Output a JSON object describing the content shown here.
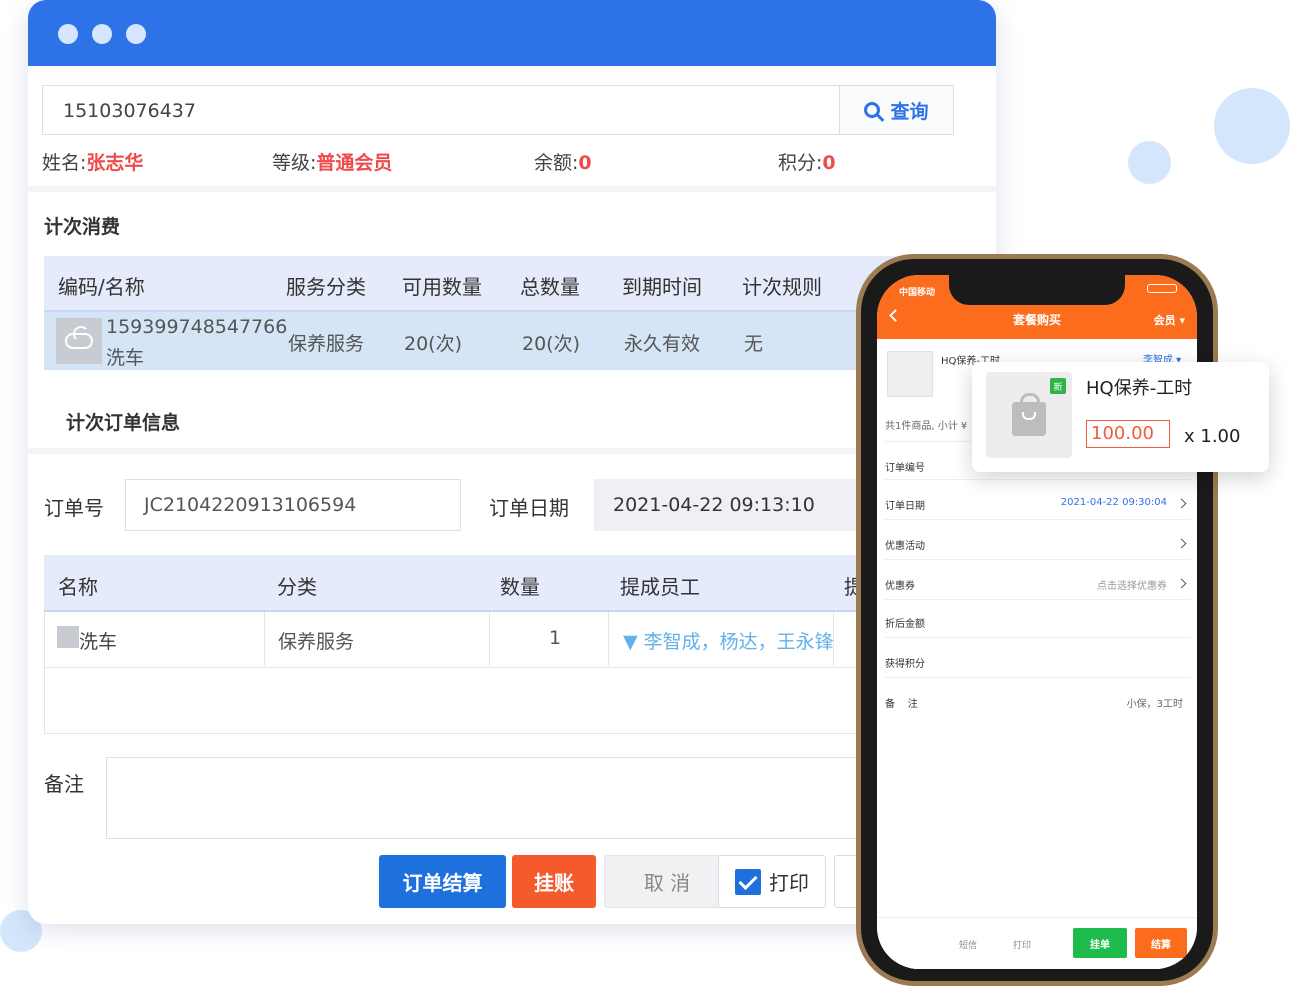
{
  "search": {
    "value": "15103076437",
    "button_label": "查询"
  },
  "member": {
    "name_label": "姓名:",
    "name_value": "张志华",
    "level_label": "等级:",
    "level_value": "普通会员",
    "balance_label": "余额:",
    "balance_value": "0",
    "points_label": "积分:",
    "points_value": "0"
  },
  "consume": {
    "title": "计次消费",
    "headers": [
      "编码/名称",
      "服务分类",
      "可用数量",
      "总数量",
      "到期时间",
      "计次规则"
    ],
    "row": {
      "code": "159399748547766",
      "name": "洗车",
      "category": "保养服务",
      "available": "20(次)",
      "total": "20(次)",
      "expiry": "永久有效",
      "rule": "无"
    }
  },
  "order": {
    "title": "计次订单信息",
    "order_no_label": "订单号",
    "order_no": "JC2104220913106594",
    "date_label": "订单日期",
    "date": "2021-04-22 09:13:10",
    "headers": [
      "名称",
      "分类",
      "数量",
      "提成员工",
      "提"
    ],
    "row": {
      "name": "洗车",
      "category": "保养服务",
      "qty": "1",
      "staff": "▼ 李智成，杨达，王永锋"
    },
    "remark_label": "备注"
  },
  "buttons": {
    "settle": "订单结算",
    "hang": "挂账",
    "cancel": "取 消",
    "print": "打印"
  },
  "phone": {
    "status_left": "中国移动",
    "title": "套餐购买",
    "member": "会员 ▾",
    "item_name": "HQ保养-工时",
    "staff_link": "李智成 ▾",
    "summary": "共1件商品, 小计 ¥",
    "rows": [
      {
        "label": "订单编号",
        "value": ""
      },
      {
        "label": "订单日期",
        "value": "2021-04-22 09:30:04"
      },
      {
        "label": "优惠活动",
        "value": ""
      },
      {
        "label": "优惠券",
        "value": "点击选择优惠券"
      },
      {
        "label": "折后金额",
        "value": ""
      },
      {
        "label": "获得积分",
        "value": ""
      },
      {
        "label": "备    注",
        "value": "小保，3工时"
      }
    ],
    "check_sms": "短信",
    "check_print": "打印",
    "btn_hang": "挂单",
    "btn_settle": "结算"
  },
  "popup": {
    "title": "HQ保养-工时",
    "price": "100.00",
    "qty": "x 1.00",
    "tag": "新"
  },
  "colors": {
    "primary": "#2e72e8",
    "danger": "#f04b4b",
    "warn": "#f55a2c",
    "phone_accent": "#fb6d1c"
  }
}
